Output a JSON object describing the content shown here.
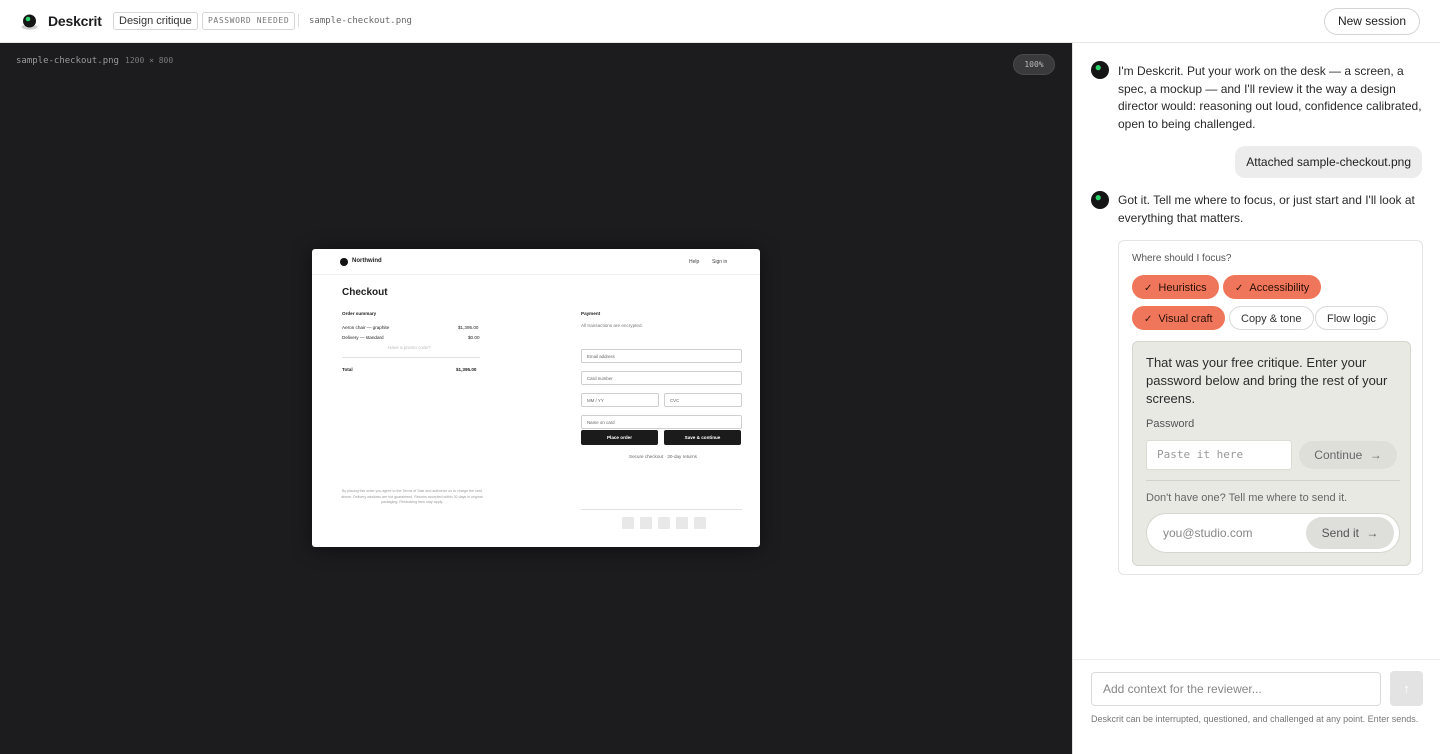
{
  "app": {
    "name": "Deskcrit",
    "mode_badge": "Design critique",
    "status_badge": "PASSWORD NEEDED",
    "current_file": "sample-checkout.png",
    "new_session_label": "New session"
  },
  "canvas": {
    "file_name": "sample-checkout.png",
    "dimensions": "1200 × 800",
    "zoom": "100%"
  },
  "mockup": {
    "brand": "Northwind",
    "nav_help": "Help",
    "nav_sign_in": "Sign in",
    "title": "Checkout",
    "order_summary": "Order summary",
    "items": [
      {
        "name": "Aeron chair — graphite",
        "price": "$1,395.00"
      },
      {
        "name": "Delivery — standard",
        "price": "$0.00"
      }
    ],
    "promo_hint": "Have a promo code?",
    "total_label": "Total",
    "total_value": "$1,395.00",
    "payment_heading": "Payment",
    "payment_note": "All transactions are encrypted.",
    "fields": {
      "email": "Email address",
      "card": "Card number",
      "expiry": "MM / YY",
      "cvc": "CVC",
      "name": "Name on card"
    },
    "place_order": "Place order",
    "save_continue": "Save & continue",
    "secure_note": "Secure checkout · 30-day returns",
    "legal": "By placing this order you agree to the Terms of Sale and authorize us to charge the card above. Delivery windows are not guaranteed. Returns accepted within 30 days in original packaging. Restocking fees may apply."
  },
  "chat": {
    "welcome": "I'm Deskcrit. Put your work on the desk — a screen, a spec, a mockup — and I'll review it the way a design director would: reasoning out loud, confidence calibrated, open to being challenged.",
    "user_attachment": "Attached sample-checkout.png",
    "reply": "Got it. Tell me where to focus, or just start and I'll look at everything that matters.",
    "focus_question": "Where should I focus?",
    "focus_options": [
      {
        "label": "Heuristics",
        "selected": true
      },
      {
        "label": "Accessibility",
        "selected": true
      },
      {
        "label": "Visual craft",
        "selected": true
      },
      {
        "label": "Copy & tone",
        "selected": false
      },
      {
        "label": "Flow logic",
        "selected": false
      }
    ],
    "gate": {
      "message": "That was your free critique. Enter your password below and bring the rest of your screens.",
      "password_label": "Password",
      "password_placeholder": "Paste it here",
      "continue_label": "Continue",
      "request_prompt": "Don't have one? Tell me where to send it.",
      "email_placeholder": "you@studio.com",
      "send_label": "Send it"
    },
    "composer_placeholder": "Add context for the reviewer...",
    "send_icon": "arrow-up-icon",
    "footer_note": "Deskcrit can be interrupted, questioned, and challenged at any point. Enter sends."
  },
  "colors": {
    "accent": "#f0765b",
    "canvas_bg": "#1c1b1e",
    "logo_green": "#2bd46a"
  }
}
